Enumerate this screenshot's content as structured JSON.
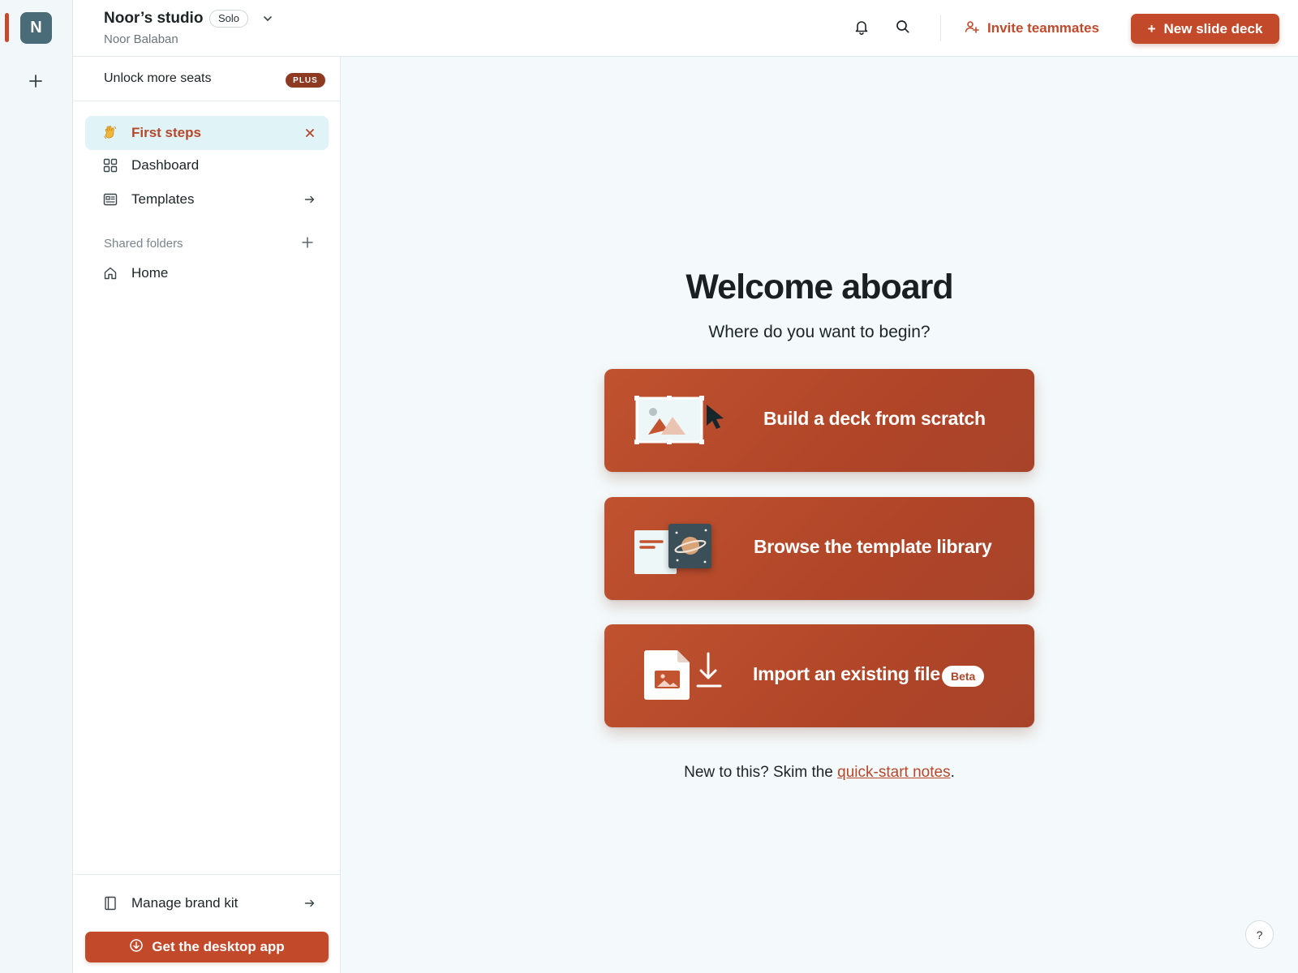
{
  "workspace": {
    "initial": "N",
    "name": "Noor’s studio",
    "plan": "Solo",
    "user": "Noor Balaban"
  },
  "topbar": {
    "invite_label": "Invite teammates",
    "new_deck_label": "New slide deck",
    "new_deck_prefix": "+"
  },
  "sidebar": {
    "unlock_label": "Unlock more seats",
    "plus_badge": "PLUS",
    "items": [
      {
        "label": "First steps",
        "icon": "waving-hand-icon",
        "active": true,
        "trail": "close-icon"
      },
      {
        "label": "Dashboard",
        "icon": "grid-icon",
        "active": false
      },
      {
        "label": "Templates",
        "icon": "template-icon",
        "active": false,
        "trail": "arrow-right-icon"
      }
    ],
    "shared_section_label": "Shared folders",
    "folders": [
      {
        "label": "Home",
        "icon": "home-icon"
      }
    ],
    "brand_kit_label": "Manage brand kit",
    "desktop_app_label": "Get the desktop app"
  },
  "main": {
    "title": "Welcome aboard",
    "subtitle": "Where do you want to begin?",
    "cards": [
      {
        "label": "Build a deck from scratch",
        "icon": "blank-slide-cursor-icon"
      },
      {
        "label": "Browse the template library",
        "icon": "template-library-icon"
      },
      {
        "label": "Import an existing file",
        "icon": "import-file-icon",
        "badge": "Beta"
      }
    ],
    "footnote_prefix": "New to this? Skim the",
    "footnote_link": "quick-start notes",
    "footnote_suffix": "."
  },
  "help_label": "?",
  "colors": {
    "accent": "#c24a2b",
    "active_nav_bg": "#e0f3f6",
    "avatar_bg": "#4a6b78",
    "page_bg": "#f4fafb"
  }
}
